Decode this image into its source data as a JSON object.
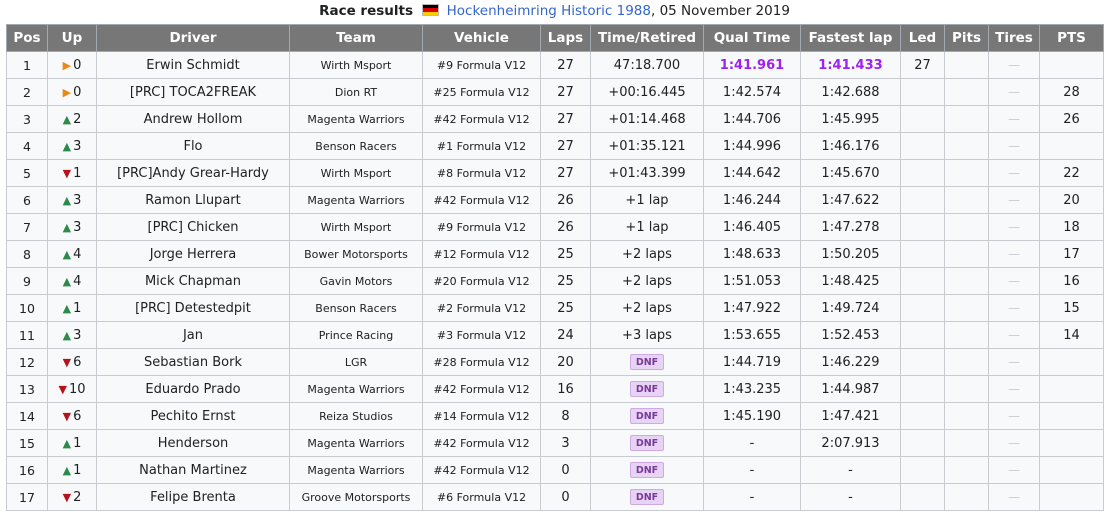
{
  "caption": {
    "title": "Race results",
    "track": "Hockenheimring Historic 1988",
    "date": ", 05 November 2019"
  },
  "columns": [
    "Pos",
    "Up",
    "Driver",
    "Team",
    "Vehicle",
    "Laps",
    "Time/Retired",
    "Qual Time",
    "Fastest lap",
    "Led",
    "Pits",
    "Tires",
    "PTS"
  ],
  "rows": [
    {
      "pos": "1",
      "dir": "same",
      "up": "0",
      "driver": "Erwin Schmidt",
      "team": "Wirth Msport",
      "vehicle": "#9 Formula V12",
      "laps": "27",
      "time": "47:18.700",
      "dnf": false,
      "qual": "1:41.961",
      "qual_best": true,
      "fastest": "1:41.433",
      "fastest_best": true,
      "led": "27",
      "pits": "",
      "tires": "—",
      "pts": ""
    },
    {
      "pos": "2",
      "dir": "same",
      "up": "0",
      "driver": "[PRC] TOCA2FREAK",
      "team": "Dion RT",
      "vehicle": "#25 Formula V12",
      "laps": "27",
      "time": "+00:16.445",
      "dnf": false,
      "qual": "1:42.574",
      "qual_best": false,
      "fastest": "1:42.688",
      "fastest_best": false,
      "led": "",
      "pits": "",
      "tires": "—",
      "pts": "28"
    },
    {
      "pos": "3",
      "dir": "up",
      "up": "2",
      "driver": "Andrew Hollom",
      "team": "Magenta Warriors",
      "vehicle": "#42 Formula V12",
      "laps": "27",
      "time": "+01:14.468",
      "dnf": false,
      "qual": "1:44.706",
      "qual_best": false,
      "fastest": "1:45.995",
      "fastest_best": false,
      "led": "",
      "pits": "",
      "tires": "—",
      "pts": "26"
    },
    {
      "pos": "4",
      "dir": "up",
      "up": "3",
      "driver": "Flo",
      "team": "Benson Racers",
      "vehicle": "#1 Formula V12",
      "laps": "27",
      "time": "+01:35.121",
      "dnf": false,
      "qual": "1:44.996",
      "qual_best": false,
      "fastest": "1:46.176",
      "fastest_best": false,
      "led": "",
      "pits": "",
      "tires": "—",
      "pts": ""
    },
    {
      "pos": "5",
      "dir": "down",
      "up": "1",
      "driver": "[PRC]Andy Grear-Hardy",
      "team": "Wirth Msport",
      "vehicle": "#8 Formula V12",
      "laps": "27",
      "time": "+01:43.399",
      "dnf": false,
      "qual": "1:44.642",
      "qual_best": false,
      "fastest": "1:45.670",
      "fastest_best": false,
      "led": "",
      "pits": "",
      "tires": "—",
      "pts": "22"
    },
    {
      "pos": "6",
      "dir": "up",
      "up": "3",
      "driver": "Ramon Llupart",
      "team": "Magenta Warriors",
      "vehicle": "#42 Formula V12",
      "laps": "26",
      "time": "+1 lap",
      "dnf": false,
      "qual": "1:46.244",
      "qual_best": false,
      "fastest": "1:47.622",
      "fastest_best": false,
      "led": "",
      "pits": "",
      "tires": "—",
      "pts": "20"
    },
    {
      "pos": "7",
      "dir": "up",
      "up": "3",
      "driver": "[PRC] Chicken",
      "team": "Wirth Msport",
      "vehicle": "#9 Formula V12",
      "laps": "26",
      "time": "+1 lap",
      "dnf": false,
      "qual": "1:46.405",
      "qual_best": false,
      "fastest": "1:47.278",
      "fastest_best": false,
      "led": "",
      "pits": "",
      "tires": "—",
      "pts": "18"
    },
    {
      "pos": "8",
      "dir": "up",
      "up": "4",
      "driver": "Jorge Herrera",
      "team": "Bower Motorsports",
      "vehicle": "#12 Formula V12",
      "laps": "25",
      "time": "+2 laps",
      "dnf": false,
      "qual": "1:48.633",
      "qual_best": false,
      "fastest": "1:50.205",
      "fastest_best": false,
      "led": "",
      "pits": "",
      "tires": "—",
      "pts": "17"
    },
    {
      "pos": "9",
      "dir": "up",
      "up": "4",
      "driver": "Mick Chapman",
      "team": "Gavin Motors",
      "vehicle": "#20 Formula V12",
      "laps": "25",
      "time": "+2 laps",
      "dnf": false,
      "qual": "1:51.053",
      "qual_best": false,
      "fastest": "1:48.425",
      "fastest_best": false,
      "led": "",
      "pits": "",
      "tires": "—",
      "pts": "16"
    },
    {
      "pos": "10",
      "dir": "up",
      "up": "1",
      "driver": "[PRC] Detestedpit",
      "team": "Benson Racers",
      "vehicle": "#2 Formula V12",
      "laps": "25",
      "time": "+2 laps",
      "dnf": false,
      "qual": "1:47.922",
      "qual_best": false,
      "fastest": "1:49.724",
      "fastest_best": false,
      "led": "",
      "pits": "",
      "tires": "—",
      "pts": "15"
    },
    {
      "pos": "11",
      "dir": "up",
      "up": "3",
      "driver": "Jan",
      "team": "Prince Racing",
      "vehicle": "#3 Formula V12",
      "laps": "24",
      "time": "+3 laps",
      "dnf": false,
      "qual": "1:53.655",
      "qual_best": false,
      "fastest": "1:52.453",
      "fastest_best": false,
      "led": "",
      "pits": "",
      "tires": "—",
      "pts": "14"
    },
    {
      "pos": "12",
      "dir": "down",
      "up": "6",
      "driver": "Sebastian Bork",
      "team": "LGR",
      "vehicle": "#28 Formula V12",
      "laps": "20",
      "time": "DNF",
      "dnf": true,
      "qual": "1:44.719",
      "qual_best": false,
      "fastest": "1:46.229",
      "fastest_best": false,
      "led": "",
      "pits": "",
      "tires": "—",
      "pts": ""
    },
    {
      "pos": "13",
      "dir": "down",
      "up": "10",
      "driver": "Eduardo Prado",
      "team": "Magenta Warriors",
      "vehicle": "#42 Formula V12",
      "laps": "16",
      "time": "DNF",
      "dnf": true,
      "qual": "1:43.235",
      "qual_best": false,
      "fastest": "1:44.987",
      "fastest_best": false,
      "led": "",
      "pits": "",
      "tires": "—",
      "pts": ""
    },
    {
      "pos": "14",
      "dir": "down",
      "up": "6",
      "driver": "Pechito Ernst",
      "team": "Reiza Studios",
      "vehicle": "#14 Formula V12",
      "laps": "8",
      "time": "DNF",
      "dnf": true,
      "qual": "1:45.190",
      "qual_best": false,
      "fastest": "1:47.421",
      "fastest_best": false,
      "led": "",
      "pits": "",
      "tires": "—",
      "pts": ""
    },
    {
      "pos": "15",
      "dir": "up",
      "up": "1",
      "driver": "Henderson",
      "team": "Magenta Warriors",
      "vehicle": "#42 Formula V12",
      "laps": "3",
      "time": "DNF",
      "dnf": true,
      "qual": "-",
      "qual_best": false,
      "fastest": "2:07.913",
      "fastest_best": false,
      "led": "",
      "pits": "",
      "tires": "—",
      "pts": ""
    },
    {
      "pos": "16",
      "dir": "up",
      "up": "1",
      "driver": "Nathan Martinez",
      "team": "Magenta Warriors",
      "vehicle": "#42 Formula V12",
      "laps": "0",
      "time": "DNF",
      "dnf": true,
      "qual": "-",
      "qual_best": false,
      "fastest": "-",
      "fastest_best": false,
      "led": "",
      "pits": "",
      "tires": "—",
      "pts": ""
    },
    {
      "pos": "17",
      "dir": "down",
      "up": "2",
      "driver": "Felipe Brenta",
      "team": "Groove Motorsports",
      "vehicle": "#6 Formula V12",
      "laps": "0",
      "time": "DNF",
      "dnf": true,
      "qual": "-",
      "qual_best": false,
      "fastest": "-",
      "fastest_best": false,
      "led": "",
      "pits": "",
      "tires": "—",
      "pts": ""
    }
  ],
  "icons": {
    "flag": "germany-flag-icon",
    "arrow_up": "arrow-up-icon",
    "arrow_down": "arrow-down-icon",
    "arrow_same": "arrow-right-icon"
  },
  "colors": {
    "header_bg": "#777777",
    "best_time": "#a020f0",
    "arrow_up": "#2c8a4a",
    "arrow_down": "#b5121b",
    "arrow_same": "#e88a1a",
    "dnf_bg": "#e7d3f3",
    "link": "#3366cc"
  }
}
